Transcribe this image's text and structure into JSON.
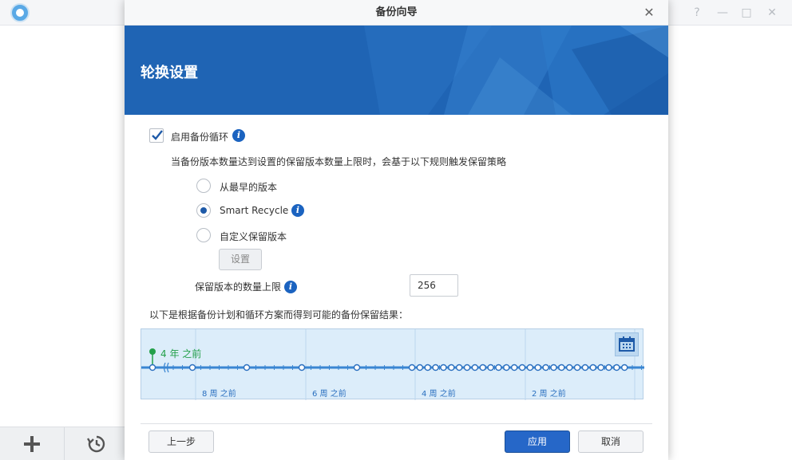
{
  "window": {
    "help": "?",
    "minimize": "—",
    "maximize": "□",
    "close": "✕"
  },
  "dialog": {
    "title": "备份向导",
    "close": "✕",
    "banner_title": "轮换设置"
  },
  "rotation": {
    "enable_label": "启用备份循环",
    "enable_checked": true,
    "description": "当备份版本数量达到设置的保留版本数量上限时，会基于以下规则触发保留策略",
    "options": [
      {
        "label": "从最早的版本",
        "selected": false
      },
      {
        "label": "Smart Recycle",
        "selected": true
      },
      {
        "label": "自定义保留版本",
        "selected": false
      }
    ],
    "settings_button": "设置",
    "max_versions_label": "保留版本的数量上限",
    "max_versions_value": "256",
    "result_text": "以下是根据备份计划和循环方案而得到可能的备份保留结果："
  },
  "timeline": {
    "start_label": "4 年 之前",
    "week_labels": [
      "8 周 之前",
      "6 周 之前",
      "4 周 之前",
      "2 周 之前"
    ]
  },
  "footer": {
    "back": "上一步",
    "apply": "应用",
    "cancel": "取消"
  },
  "colors": {
    "accent": "#2667c8",
    "banner": "#1f64b4",
    "timeline_bg": "#dcedfa",
    "green": "#23a04a"
  }
}
